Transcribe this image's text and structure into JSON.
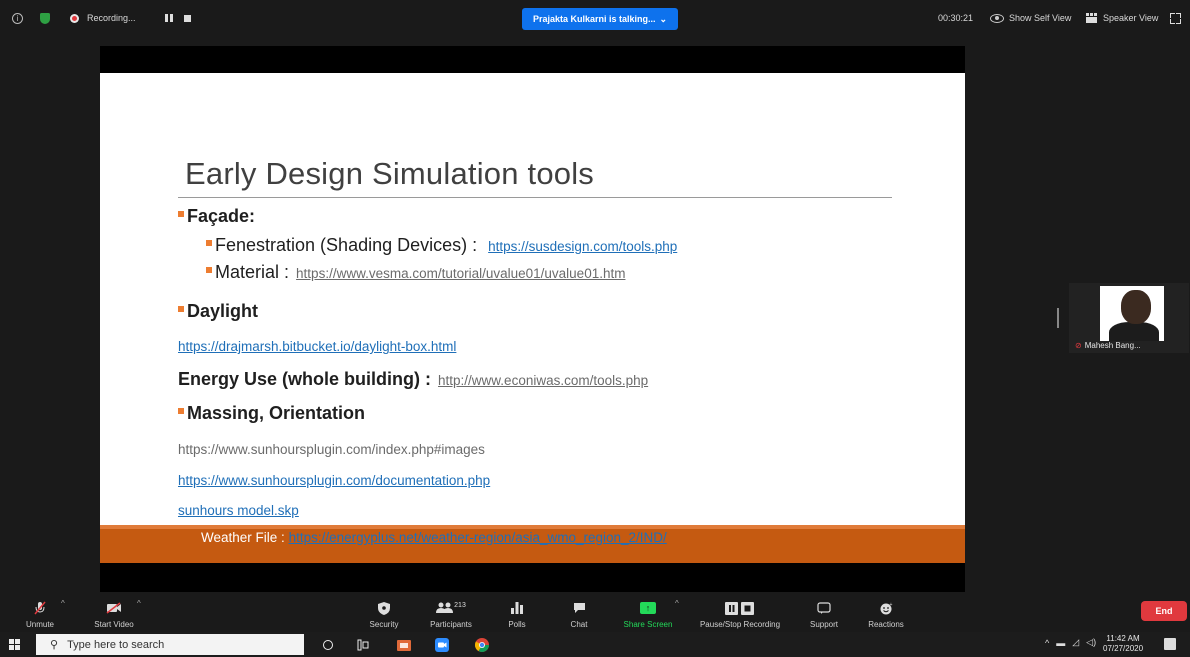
{
  "topbar": {
    "recording_label": "Recording...",
    "talking_label": "Prajakta Kulkarni is talking...",
    "talking_caret": "⌄",
    "timer": "00:30:21",
    "show_self_view": "Show Self View",
    "speaker_view": "Speaker View"
  },
  "slide": {
    "title": "Early Design Simulation tools",
    "facade_heading": "Façade:",
    "fenestration_label": "Fenestration (Shading Devices) :",
    "fenestration_link": "https://susdesign.com/tools.php",
    "material_label": "Material  :",
    "material_link": "https://www.vesma.com/tutorial/uvalue01/uvalue01.htm",
    "daylight_heading": "Daylight",
    "daylight_link": "https://drajmarsh.bitbucket.io/daylight-box.html",
    "energy_label": "Energy Use (whole building) :",
    "energy_link": "http://www.econiwas.com/tools.php",
    "massing_heading": "Massing, Orientation",
    "massing_link1": "https://www.sunhoursplugin.com/index.php#images",
    "massing_link2": "https://www.sunhoursplugin.com/documentation.php",
    "massing_link3": "sunhours model.skp",
    "weather_label": "Weather File :",
    "weather_link": "https://energyplus.net/weather-region/asia_wmo_region_2/IND/"
  },
  "thumbnail": {
    "name": "Mahesh Bang..."
  },
  "toolbar": {
    "unmute": "Unmute",
    "start_video": "Start Video",
    "security": "Security",
    "participants": "Participants",
    "participants_count": "213",
    "polls": "Polls",
    "chat": "Chat",
    "share_screen": "Share Screen",
    "pause_stop_recording": "Pause/Stop Recording",
    "support": "Support",
    "reactions": "Reactions",
    "end": "End"
  },
  "taskbar": {
    "search_placeholder": "Type here to search",
    "time": "11:42 AM",
    "date": "07/27/2020"
  },
  "colors": {
    "zoom_blue": "#0e72ed",
    "accent_orange": "#ed7d31",
    "slide_bar": "#c55a11",
    "end_red": "#e0393e",
    "share_green": "#23d959",
    "link_blue": "#1f6fb8"
  },
  "icons": [
    "info-icon",
    "shield-icon",
    "record-icon",
    "pause-icon",
    "stop-icon",
    "eye-icon",
    "speaker-view-icon",
    "fullscreen-icon",
    "mic-muted-icon",
    "video-off-icon",
    "security-icon",
    "participants-icon",
    "polls-icon",
    "chat-icon",
    "share-screen-icon",
    "pause-stop-recording-icon",
    "support-icon",
    "reactions-icon",
    "windows-icon",
    "search-icon",
    "task-view-icon",
    "file-explorer-icon",
    "zoom-app-icon",
    "chrome-icon",
    "circle-icon"
  ]
}
